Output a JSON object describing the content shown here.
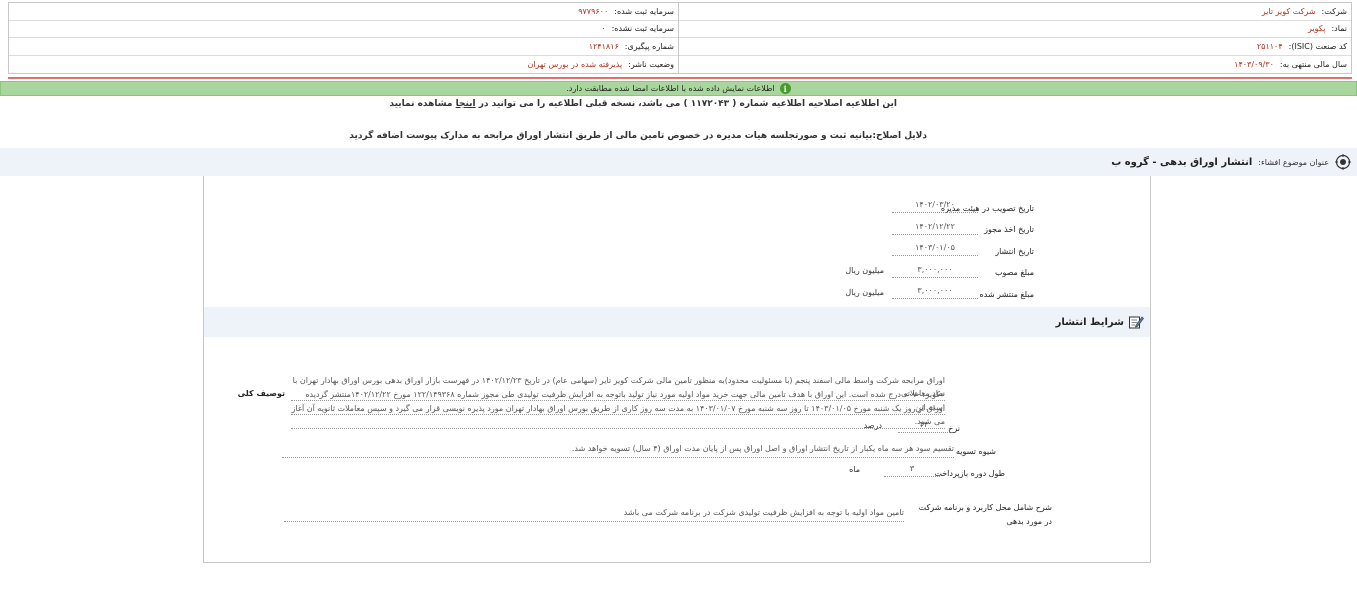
{
  "header": {
    "right": [
      {
        "label": "شرکت:",
        "value": "شرکت کویر تایر"
      },
      {
        "label": "نماد:",
        "value": "پکویر"
      },
      {
        "label": "کد صنعت (ISIC):",
        "value": "۲۵۱۱۰۴"
      },
      {
        "label": "سال مالی منتهی به:",
        "value": "۱۴۰۳/۰۹/۳۰"
      }
    ],
    "left": [
      {
        "label": "سرمایه ثبت شده:",
        "value": "۹۷۷۹۶۰۰"
      },
      {
        "label": "سرمایه ثبت نشده:",
        "value": "۰"
      },
      {
        "label": "شماره پیگیری:",
        "value": "۱۲۴۱۸۱۶"
      },
      {
        "label": "وضعیت ناشر:",
        "value": "پذیرفته شده در بورس تهران"
      }
    ]
  },
  "banner": {
    "message": "اطلاعات نمایش داده شده با اطلاعات امضا شده مطابقت دارد.",
    "icon": "info-icon",
    "color": "#a9d69d"
  },
  "notice": {
    "prefix": "این اطلاعیه اصلاحیه اطلاعیه شماره ( ۱۱۷۲۰۴۳ ) می باشد، نسخه قبلی اطلاعیه را می توانید در",
    "link": "اینجا",
    "suffix": "مشاهده نمایید"
  },
  "reason": "دلایل اصلاح:بیانیه ثبت و صورتجلسه هیات مدیره در خصوص تامین مالی از طریق انتشار اوراق مرابحه به مدارک پیوست اضافه گردید",
  "subject": {
    "label": "عنوان موضوع افشاء:",
    "value": "انتشار اوراق بدهی - گروه ب"
  },
  "fields": {
    "board_approval_date": {
      "label": "تاریخ تصویب در هیئت مدیره",
      "value": "۱۴۰۲/۰۳/۲۰"
    },
    "permit_date": {
      "label": "تاریخ اخذ مجوز",
      "value": "۱۴۰۲/۱۲/۲۲"
    },
    "issue_date": {
      "label": "تاریخ انتشار",
      "value": "۱۴۰۳/۰۱/۰۵"
    },
    "approved_amount": {
      "label": "مبلغ مصوب",
      "value": "۳,۰۰۰,۰۰۰",
      "unit": "میلیون ریال"
    },
    "issued_amount": {
      "label": "مبلغ منتشر شده",
      "value": "۳,۰۰۰,۰۰۰",
      "unit": "میلیون ریال"
    }
  },
  "conditions": {
    "title": "شرایط انتشار",
    "general_desc": {
      "label": "توصیف کلی",
      "line1": "اوراق مرابحه شرکت واسط مالی اسفند پنجم (با مسئولیت محدود)به منظور تامین مالی شرکت کویر تایر (سهامی عام) در تاریخ ۱۴۰۲/۱۲/۲۳ در فهرست بازار اوراق بدهی بورس اوراق بهادار تهران با نماد معاملاتی",
      "line2": "«کویر۰۷۰۱» درج شده است. این اوراق با هدف تامین مالی جهت خرید مواد اولیه مورد نیاز تولید باتوجه به افزایش ظرفیت تولیدی طی مجوز شماره ۱۲۲/۱۴۹۳۶۸ مورخ ۱۴۰۲/۱۲/۲۲منتشر گردیده است.این",
      "line3": "اوراق از روز یک شنبه مورخ ۱۴۰۳/۰۱/۰۵ تا روز سه شنبه مورخ ۱۴۰۳/۰۱/۰۷ به مدت سه روز کاری از طریق بورس اوراق بهادار تهران مورد پذیره نویسی قرار می گیرد و سپس معاملات ثانویه آن آغاز می شود."
    },
    "rate": {
      "label": "نرخ",
      "value": "۲۴",
      "unit": "درصد"
    },
    "settlement": {
      "label": "شیوه تسویه",
      "value": "تقسیم سود هر سه ماه یکبار از تاریخ انتشار اوراق و اصل اوراق پس از پایان مدت اوراق (۴ سال) تسویه خواهد شد."
    },
    "repayment_period": {
      "label": "طول دوره بازپرداخت",
      "value": "۳",
      "unit": "ماه"
    },
    "usage": {
      "label": "شرح شامل محل کاربرد و برنامه شرکت در مورد بدهی",
      "value": "تامین مواد اولیه با توجه به افزایش ظرفیت تولیدی شرکت در برنامه شرکت می باشد"
    }
  }
}
